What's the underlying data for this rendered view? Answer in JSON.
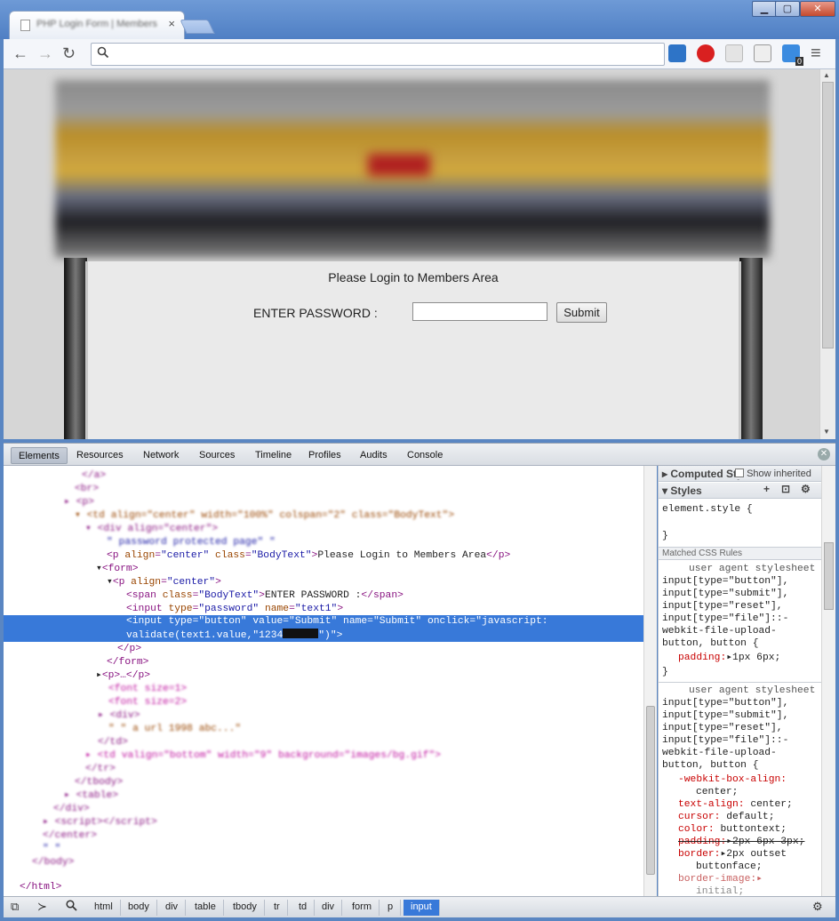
{
  "browser": {
    "tab_title": "PHP Login Form | Members",
    "tab_close": "×",
    "window_controls": {
      "minimize": "▁",
      "maximize": "▢",
      "close": "✕"
    },
    "nav": {
      "back": "←",
      "forward": "→",
      "reload": "↻"
    },
    "omnibox": {
      "value": "",
      "placeholder": ""
    },
    "menu": "≡",
    "ext_badge": "0"
  },
  "page": {
    "login_title": "Please Login to Members Area",
    "password_label": "ENTER PASSWORD :",
    "submit_label": "Submit"
  },
  "devtools": {
    "tabs": [
      "Elements",
      "Resources",
      "Network",
      "Sources",
      "Timeline",
      "Profiles",
      "Audits",
      "Console"
    ],
    "elements": {
      "p_line": {
        "open": "<p ",
        "attr1": "align",
        "val1": "\"center\"",
        "attr2": "class",
        "val2": "\"BodyText\"",
        "text": "Please Login to Members Area",
        "close": "</p>"
      },
      "form_open": "<form>",
      "p2_open": {
        "open": "<p ",
        "attr": "align",
        "val": "\"center\"",
        "end": ">"
      },
      "span_line": {
        "open": "<span ",
        "attr": "class",
        "val": "\"BodyText\"",
        "text": "ENTER PASSWORD :",
        "close": "</span>"
      },
      "input_pw": {
        "open": "<input ",
        "a1": "type",
        "v1": "\"password\"",
        "a2": "name",
        "v2": "\"text1\"",
        "end": ">"
      },
      "input_btn_1": "<input type=\"button\" value=\"Submit\" name=\"Submit\" onclick=\"javascript:",
      "input_btn_2a": "validate(text1.value,\"1234",
      "input_btn_2b": "\")\">",
      "p2_close": "</p>",
      "form_close": "</form>",
      "p_collapsed": "<p>…</p>",
      "html_close": "</html>"
    },
    "sidebar": {
      "computed": "Computed Style",
      "show_inherited": "Show inherited",
      "styles": "Styles",
      "element_style": "element.style {",
      "element_style_close": "}",
      "matched": "Matched CSS Rules",
      "ua1": "user agent stylesheet",
      "sel1": "input[type=\"button\"],\ninput[type=\"submit\"],\ninput[type=\"reset\"],\ninput[type=\"file\"]::-\nwebkit-file-upload-\nbutton, button {",
      "decl1_prop": "padding:",
      "decl1_val": "1px 6px;",
      "close1": "}",
      "ua2": "user agent stylesheet",
      "sel2": "input[type=\"button\"],\ninput[type=\"submit\"],\ninput[type=\"reset\"],\ninput[type=\"file\"]::-\nwebkit-file-upload-\nbutton, button {",
      "d1": "-webkit-box-align:",
      "d1v": "center;",
      "d2": "text-align:",
      "d2v": "center;",
      "d3": "cursor:",
      "d3v": "default;",
      "d4": "color:",
      "d4v": "buttontext;",
      "d5": "padding:",
      "d5v": "2px 6px 3px;",
      "d6": "border:",
      "d6v": "2px outset",
      "d6v2": "buttonface;",
      "d7": "border-image:",
      "d7v": "initial;"
    },
    "breadcrumbs": [
      "html",
      "body",
      "div",
      "table",
      "tbody",
      "tr",
      "td",
      "div",
      "form",
      "p",
      "input"
    ]
  }
}
